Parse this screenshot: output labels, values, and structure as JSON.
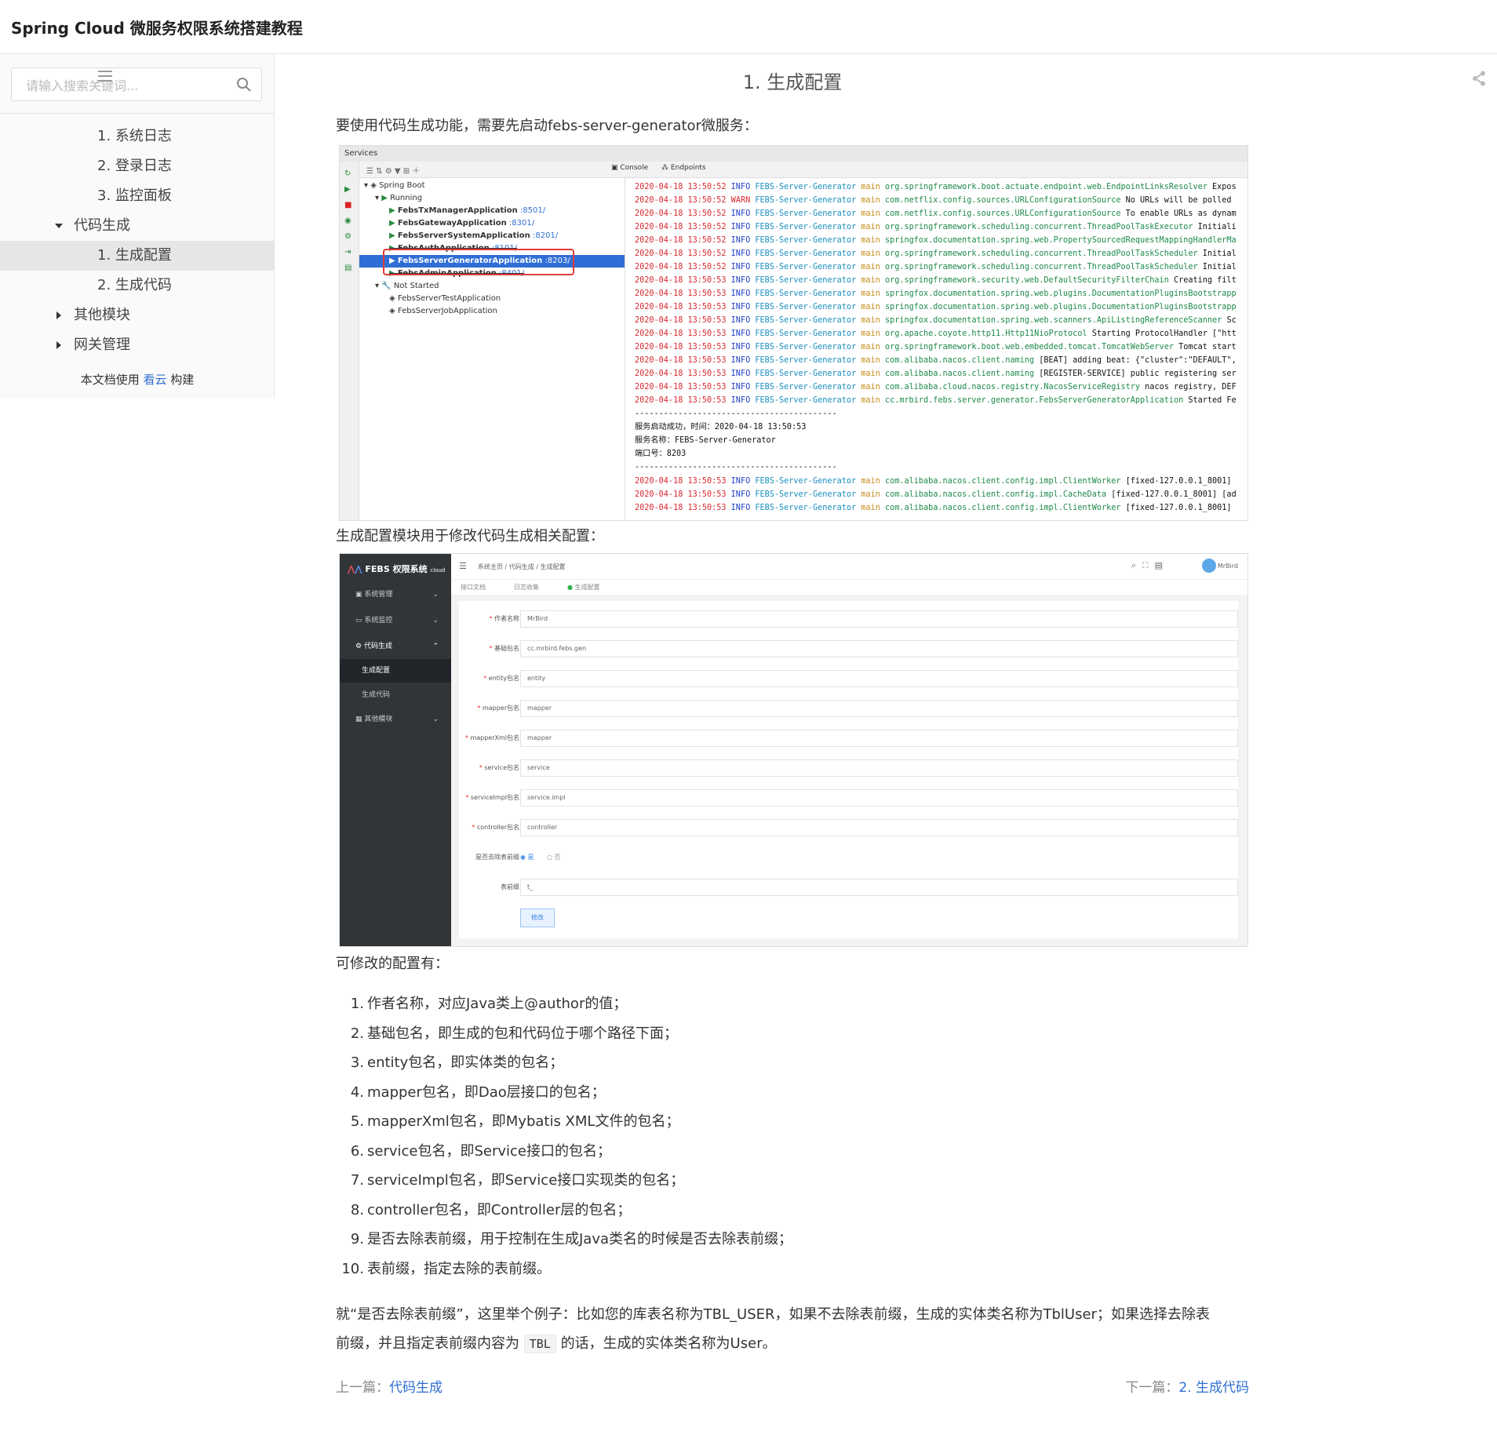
{
  "header": {
    "title": "Spring Cloud 微服务权限系统搭建教程"
  },
  "search": {
    "placeholder": "请输入搜索关键词..."
  },
  "sidebar": {
    "items": [
      {
        "label": "1. 系统日志"
      },
      {
        "label": "2. 登录日志"
      },
      {
        "label": "3. 监控面板"
      },
      {
        "label": "代码生成"
      },
      {
        "label": "1. 生成配置"
      },
      {
        "label": "2. 生成代码"
      },
      {
        "label": "其他模块"
      },
      {
        "label": "网关管理"
      }
    ],
    "built_prefix": "本文档使用",
    "built_link": "看云",
    "built_suffix": "构建"
  },
  "article": {
    "title": "1. 生成配置",
    "intro": "要使用代码生成功能，需要先启动febs-server-generator微服务：",
    "desc": "生成配置模块用于修改代码生成相关配置：",
    "editable": "可修改的配置有：",
    "list": [
      "作者名称，对应Java类上@author的值；",
      "基础包名，即生成的包和代码位于哪个路径下面；",
      "entity包名，即实体类的包名；",
      "mapper包名，即Dao层接口的包名；",
      "mapperXml包名，即Mybatis XML文件的包名；",
      "service包名，即Service接口的包名；",
      "serviceImpl包名，即Service接口实现类的包名；",
      "controller包名，即Controller层的包名；",
      "是否去除表前缀，用于控制在生成Java类名的时候是否去除表前缀；",
      "表前缀，指定去除的表前缀。"
    ],
    "example_1": "就“是否去除表前缀”，这里举个例子：比如您的库表名称为TBL_USER，如果不去除表前缀，生成的实体类名称为TblUser；如果选择去除表",
    "example_2a": "前缀，并且指定表前缀内容为",
    "example_code": "TBL",
    "example_2b": "的话，生成的实体类名称为User。"
  },
  "pager": {
    "prev_label": "上一篇：",
    "prev_link": "代码生成",
    "next_label": "下一篇：",
    "next_link": "2. 生成代码"
  },
  "shot1": {
    "panel_title": "Services",
    "tab_console": "Console",
    "tab_endpoints": "Endpoints",
    "tree": [
      {
        "text": "Spring Boot"
      },
      {
        "text": "Running"
      },
      {
        "name": "FebsTxManagerApplication",
        "port": ":8501/"
      },
      {
        "name": "FebsGatewayApplication",
        "port": ":8301/"
      },
      {
        "name": "FebsServerSystemApplication",
        "port": ":8201/"
      },
      {
        "name": "FebsAuthApplication",
        "port": ":8101/"
      },
      {
        "name": "FebsServerGeneratorApplication",
        "port": ":8203/"
      },
      {
        "name": "FebsAdminApplication",
        "port": ":8401/"
      },
      {
        "text": "Not Started"
      },
      {
        "text": "FebsServerTestApplication"
      },
      {
        "text": "FebsServerJobApplication"
      }
    ],
    "logs": [
      {
        "dt": "2020-04-18 13:50:52",
        "lv": "INFO",
        "cl": "org.springframework.boot.actuate.endpoint.web.EndpointLinksResolver",
        "ms": "Expos"
      },
      {
        "dt": "2020-04-18 13:50:52",
        "lv": "WARN",
        "cl": "com.netflix.config.sources.URLConfigurationSource",
        "ms": "No URLs will be polled"
      },
      {
        "dt": "2020-04-18 13:50:52",
        "lv": "INFO",
        "cl": "com.netflix.config.sources.URLConfigurationSource",
        "ms": "To enable URLs as dynam"
      },
      {
        "dt": "2020-04-18 13:50:52",
        "lv": "INFO",
        "cl": "org.springframework.scheduling.concurrent.ThreadPoolTaskExecutor",
        "ms": "Initiali"
      },
      {
        "dt": "2020-04-18 13:50:52",
        "lv": "INFO",
        "cl": "springfox.documentation.spring.web.PropertySourcedRequestMappingHandlerMa",
        "ms": ""
      },
      {
        "dt": "2020-04-18 13:50:52",
        "lv": "INFO",
        "cl": "org.springframework.scheduling.concurrent.ThreadPoolTaskScheduler",
        "ms": "Initial"
      },
      {
        "dt": "2020-04-18 13:50:52",
        "lv": "INFO",
        "cl": "org.springframework.scheduling.concurrent.ThreadPoolTaskScheduler",
        "ms": "Initial"
      },
      {
        "dt": "2020-04-18 13:50:53",
        "lv": "INFO",
        "cl": "org.springframework.security.web.DefaultSecurityFilterChain",
        "ms": "Creating filt"
      },
      {
        "dt": "2020-04-18 13:50:53",
        "lv": "INFO",
        "cl": "springfox.documentation.spring.web.plugins.DocumentationPluginsBootstrapp",
        "ms": ""
      },
      {
        "dt": "2020-04-18 13:50:53",
        "lv": "INFO",
        "cl": "springfox.documentation.spring.web.plugins.DocumentationPluginsBootstrapp",
        "ms": ""
      },
      {
        "dt": "2020-04-18 13:50:53",
        "lv": "INFO",
        "cl": "springfox.documentation.spring.web.scanners.ApiListingReferenceScanner",
        "ms": "Sc"
      },
      {
        "dt": "2020-04-18 13:50:53",
        "lv": "INFO",
        "cl": "org.apache.coyote.http11.Http11NioProtocol",
        "ms": "Starting ProtocolHandler [\"htt"
      },
      {
        "dt": "2020-04-18 13:50:53",
        "lv": "INFO",
        "cl": "org.springframework.boot.web.embedded.tomcat.TomcatWebServer",
        "ms": "Tomcat start"
      },
      {
        "dt": "2020-04-18 13:50:53",
        "lv": "INFO",
        "cl": "com.alibaba.nacos.client.naming",
        "ms": "[BEAT] adding beat: {\"cluster\":\"DEFAULT\","
      },
      {
        "dt": "2020-04-18 13:50:53",
        "lv": "INFO",
        "cl": "com.alibaba.nacos.client.naming",
        "ms": "[REGISTER-SERVICE] public registering ser"
      },
      {
        "dt": "2020-04-18 13:50:53",
        "lv": "INFO",
        "cl": "com.alibaba.cloud.nacos.registry.NacosServiceRegistry",
        "ms": "nacos registry, DEF"
      },
      {
        "dt": "2020-04-18 13:50:53",
        "lv": "INFO",
        "cl": "cc.mrbird.febs.server.generator.FebsServerGeneratorApplication",
        "ms": "Started Fe"
      }
    ],
    "service_name": "FEBS-Server-Generator",
    "thread": "main",
    "separator": "------------------------------------------",
    "started_1": "服务启动成功，时间：2020-04-18 13:50:53",
    "started_2": "服务名称：FEBS-Server-Generator",
    "started_3": "端口号：8203",
    "tail_logs": [
      {
        "dt": "2020-04-18 13:50:53",
        "lv": "INFO",
        "cl": "com.alibaba.nacos.client.config.impl.ClientWorker",
        "ms": "[fixed-127.0.0.1_8001]"
      },
      {
        "dt": "2020-04-18 13:50:53",
        "lv": "INFO",
        "cl": "com.alibaba.nacos.client.config.impl.CacheData",
        "ms": "[fixed-127.0.0.1_8001] [ad"
      },
      {
        "dt": "2020-04-18 13:50:53",
        "lv": "INFO",
        "cl": "com.alibaba.nacos.client.config.impl.ClientWorker",
        "ms": "[fixed-127.0.0.1_8001]"
      }
    ]
  },
  "shot2": {
    "logo": "FEBS 权限系统",
    "logo_sub": "cloud",
    "menu": [
      {
        "label": "系统管理"
      },
      {
        "label": "系统监控"
      },
      {
        "label": "代码生成"
      },
      {
        "label": "生成配置"
      },
      {
        "label": "生成代码"
      },
      {
        "label": "其他模块"
      }
    ],
    "breadcrumb": "系统主页 / 代码生成 / 生成配置",
    "user": "MrBird",
    "tabs": [
      "接口文档",
      "日志收集",
      "生成配置"
    ],
    "fields": [
      {
        "label": "作者名称",
        "value": "MrBird"
      },
      {
        "label": "基础包名",
        "value": "cc.mrbird.febs.gen"
      },
      {
        "label": "entity包名",
        "value": "entity"
      },
      {
        "label": "mapper包名",
        "value": "mapper"
      },
      {
        "label": "mapperXml包名",
        "value": "mapper"
      },
      {
        "label": "service包名",
        "value": "service"
      },
      {
        "label": "serviceImpl包名",
        "value": "service.impl"
      },
      {
        "label": "controller包名",
        "value": "controller"
      }
    ],
    "prefix_question": "是否去除表前缀",
    "yes": "是",
    "no": "否",
    "prefix_label": "表前缀",
    "prefix_value": "t_",
    "submit": "修改"
  }
}
